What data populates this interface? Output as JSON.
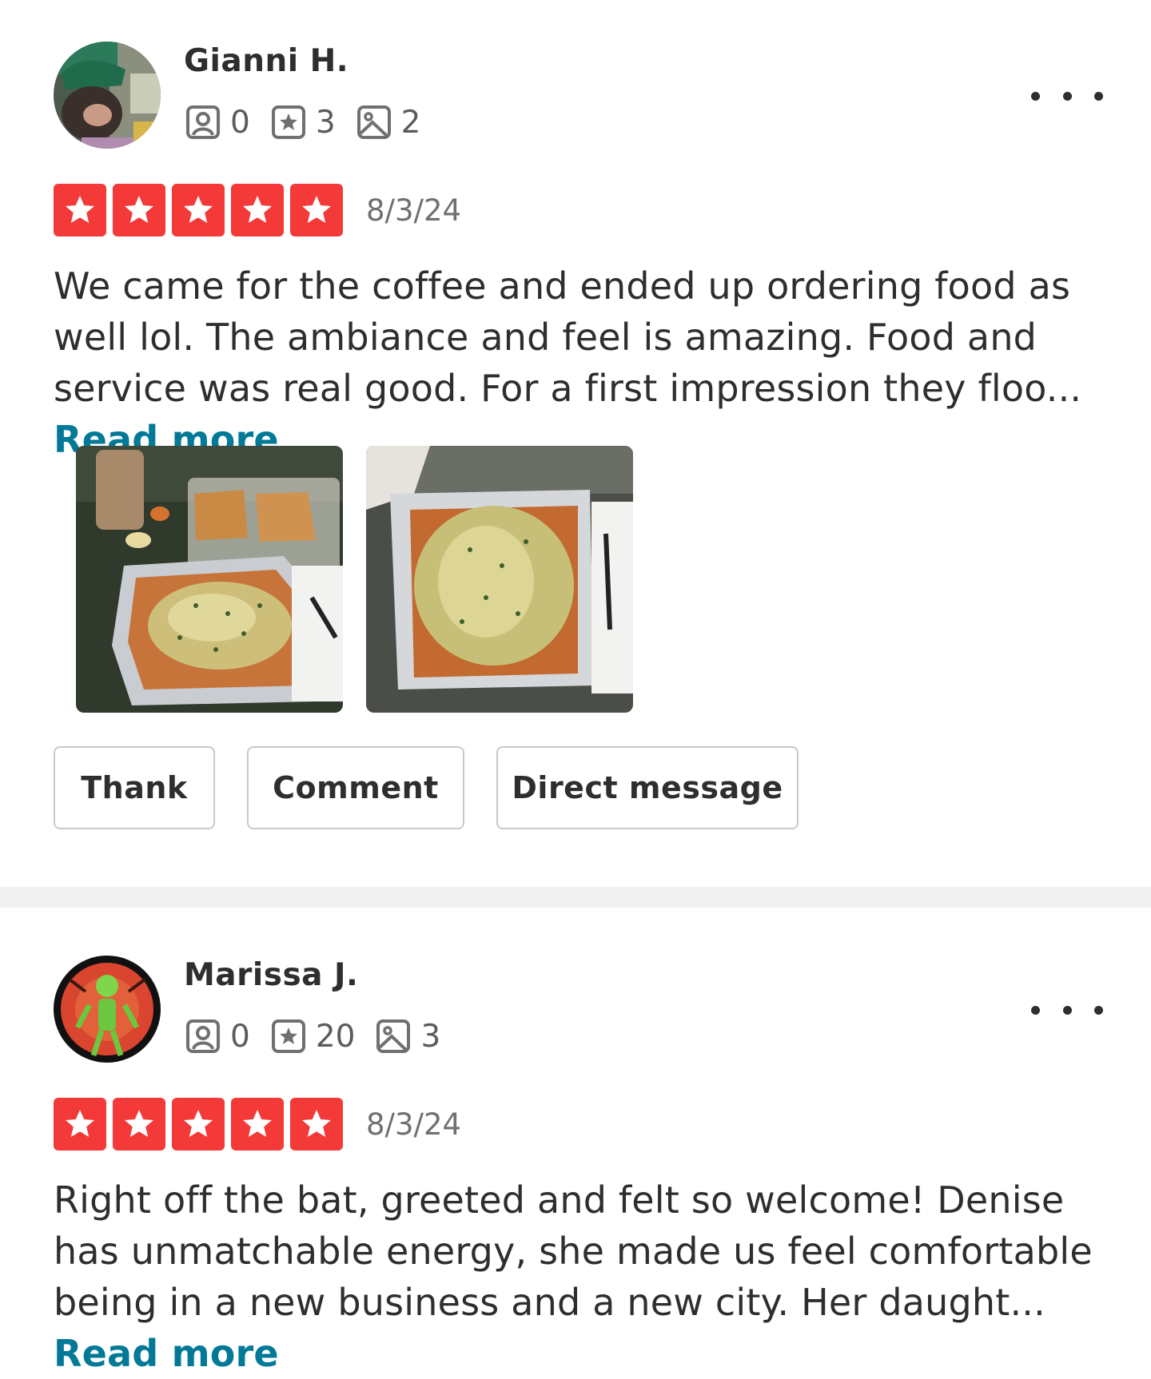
{
  "reviews": [
    {
      "user": {
        "name": "Gianni H.",
        "friends": "0",
        "reviews": "3",
        "photos": "2"
      },
      "rating": 5,
      "date": "8/3/24",
      "text": "We came for the coffee and ended up ordering food as well lol. The ambiance and feel is amazing. Food and service was real good. For a first impression they floo...",
      "read_more": "Read more",
      "actions": {
        "thank": "Thank",
        "comment": "Comment",
        "direct_message": "Direct message"
      }
    },
    {
      "user": {
        "name": "Marissa J.",
        "friends": "0",
        "reviews": "20",
        "photos": "3"
      },
      "rating": 5,
      "date": "8/3/24",
      "text": "Right off the bat, greeted and felt so welcome! Denise has unmatchable energy, she made us feel comfortable being in a new business and a new city. Her daught...",
      "read_more": "Read more"
    }
  ],
  "colors": {
    "star": "#f43939",
    "link": "#027a97",
    "text": "#2d2e2f",
    "divider": "#f1f1f1"
  },
  "icons": {
    "friends": "friends-icon",
    "reviews": "review-star-icon",
    "photos": "photo-icon",
    "more": "more-options-icon"
  }
}
